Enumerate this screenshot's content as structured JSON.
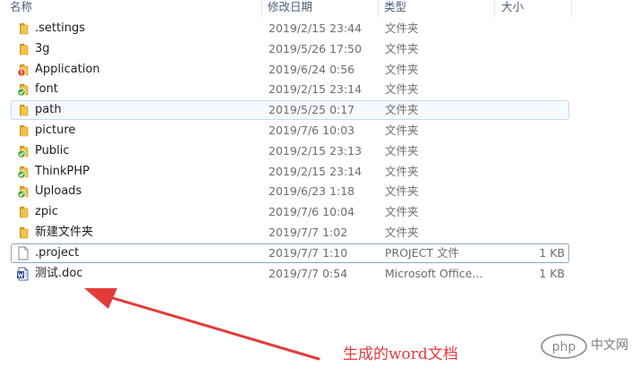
{
  "columns": {
    "name": "名称",
    "modified": "修改日期",
    "type": "类型",
    "size": "大小"
  },
  "files": [
    {
      "name": ".settings",
      "modified": "2019/2/15 23:44",
      "type": "文件夹",
      "size": "",
      "icon": "folder-icon"
    },
    {
      "name": "3g",
      "modified": "2019/5/26 17:50",
      "type": "文件夹",
      "size": "",
      "icon": "folder-icon"
    },
    {
      "name": "Application",
      "modified": "2019/6/24 0:56",
      "type": "文件夹",
      "size": "",
      "icon": "folder-error-icon"
    },
    {
      "name": "font",
      "modified": "2019/2/15 23:14",
      "type": "文件夹",
      "size": "",
      "icon": "folder-synced-icon"
    },
    {
      "name": "path",
      "modified": "2019/5/25 0:17",
      "type": "文件夹",
      "size": "",
      "icon": "folder-icon",
      "state": "hover"
    },
    {
      "name": "picture",
      "modified": "2019/7/6 10:03",
      "type": "文件夹",
      "size": "",
      "icon": "folder-icon"
    },
    {
      "name": "Public",
      "modified": "2019/2/15 23:13",
      "type": "文件夹",
      "size": "",
      "icon": "folder-synced-icon"
    },
    {
      "name": "ThinkPHP",
      "modified": "2019/2/15 23:14",
      "type": "文件夹",
      "size": "",
      "icon": "folder-synced-icon"
    },
    {
      "name": "Uploads",
      "modified": "2019/6/23 1:18",
      "type": "文件夹",
      "size": "",
      "icon": "folder-synced-icon"
    },
    {
      "name": "zpic",
      "modified": "2019/7/6 10:04",
      "type": "文件夹",
      "size": "",
      "icon": "folder-icon"
    },
    {
      "name": "新建文件夹",
      "modified": "2019/7/7 1:02",
      "type": "文件夹",
      "size": "",
      "icon": "folder-icon"
    },
    {
      "name": ".project",
      "modified": "2019/7/7 1:10",
      "type": "PROJECT 文件",
      "size": "1 KB",
      "icon": "blank-file-icon",
      "state": "focus"
    },
    {
      "name": "测试.doc",
      "modified": "2019/7/7 0:54",
      "type": "Microsoft Office...",
      "size": "1 KB",
      "icon": "word-document-icon"
    }
  ],
  "annotation": "生成的word文档",
  "watermark": {
    "logo": "php",
    "text": "中文网"
  },
  "colors": {
    "annotation": "#e53a3a",
    "folder": "#e8b53a",
    "hover_border": "#c3d9ef"
  }
}
